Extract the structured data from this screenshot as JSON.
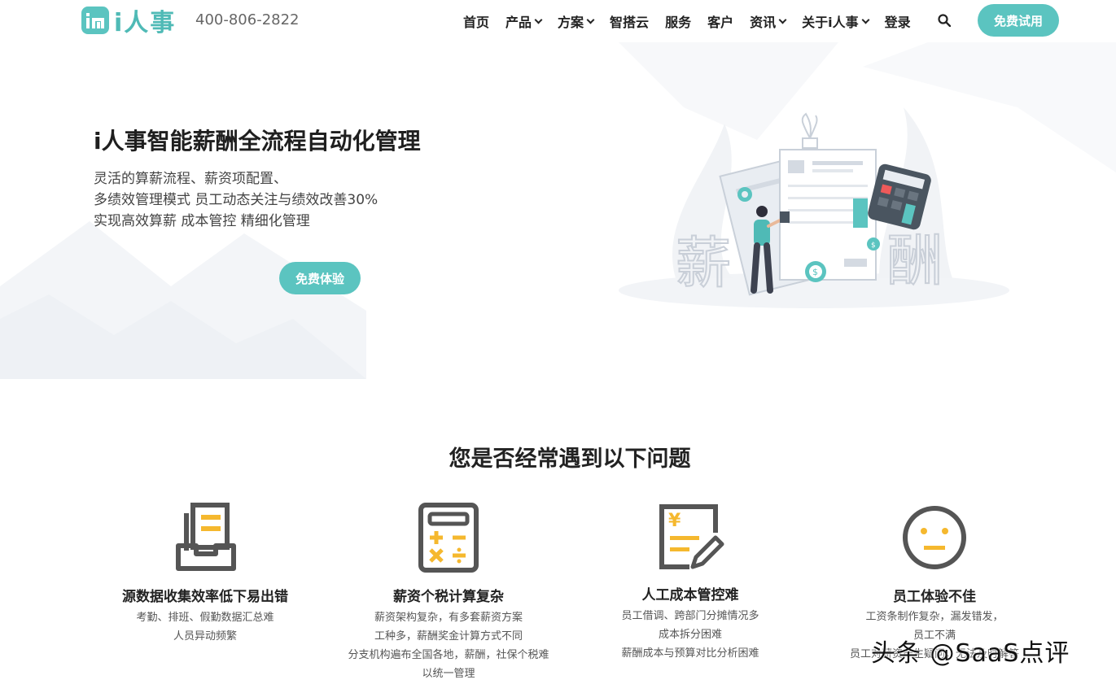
{
  "header": {
    "logo_text": "i人事",
    "phone": "400-806-2822",
    "nav": [
      {
        "label": "首页",
        "dropdown": false
      },
      {
        "label": "产品",
        "dropdown": true
      },
      {
        "label": "方案",
        "dropdown": true
      },
      {
        "label": "智搭云",
        "dropdown": false
      },
      {
        "label": "服务",
        "dropdown": false
      },
      {
        "label": "客户",
        "dropdown": false
      },
      {
        "label": "资讯",
        "dropdown": true
      },
      {
        "label": "关于i人事",
        "dropdown": true
      },
      {
        "label": "登录",
        "dropdown": false
      }
    ],
    "trial_button": "免费试用"
  },
  "hero": {
    "title": "i人事智能薪酬全流程自动化管理",
    "desc_line1": "灵活的算薪流程、薪资项配置、",
    "desc_line2": "多绩效管理模式 员工动态关注与绩效改善30%",
    "desc_line3": "实现高效算薪 成本管控 精细化管理",
    "button": "免费体验",
    "illus_char_left": "薪",
    "illus_char_right": "酬"
  },
  "problems": {
    "title": "您是否经常遇到以下问题",
    "cards": [
      {
        "icon": "inbox-document-icon",
        "title": "源数据收集效率低下易出错",
        "lines": [
          "考勤、排班、假勤数据汇总难",
          "人员异动频繁"
        ]
      },
      {
        "icon": "calculator-icon",
        "title": "薪资个税计算复杂",
        "lines": [
          "薪资架构复杂，有多套薪资方案",
          "工种多，薪酬奖金计算方式不同",
          "分支机构遍布全国各地，薪酬，社保个税难",
          "以统一管理"
        ]
      },
      {
        "icon": "cost-edit-icon",
        "title": "人工成本管控难",
        "lines": [
          "员工借调、跨部门分摊情况多",
          "成本拆分困难",
          "薪酬成本与预算对比分析困难"
        ]
      },
      {
        "icon": "neutral-face-icon",
        "title": "员工体验不佳",
        "lines": [
          "工资条制作复杂，漏发错发，",
          "员工不满",
          "员工对薪资产生疑问，无法及时解答"
        ]
      }
    ]
  },
  "watermark": "头条 @SaaS点评",
  "colors": {
    "accent": "#5bc4c0",
    "icon_gray": "#555555",
    "icon_yellow": "#f5b82e"
  }
}
